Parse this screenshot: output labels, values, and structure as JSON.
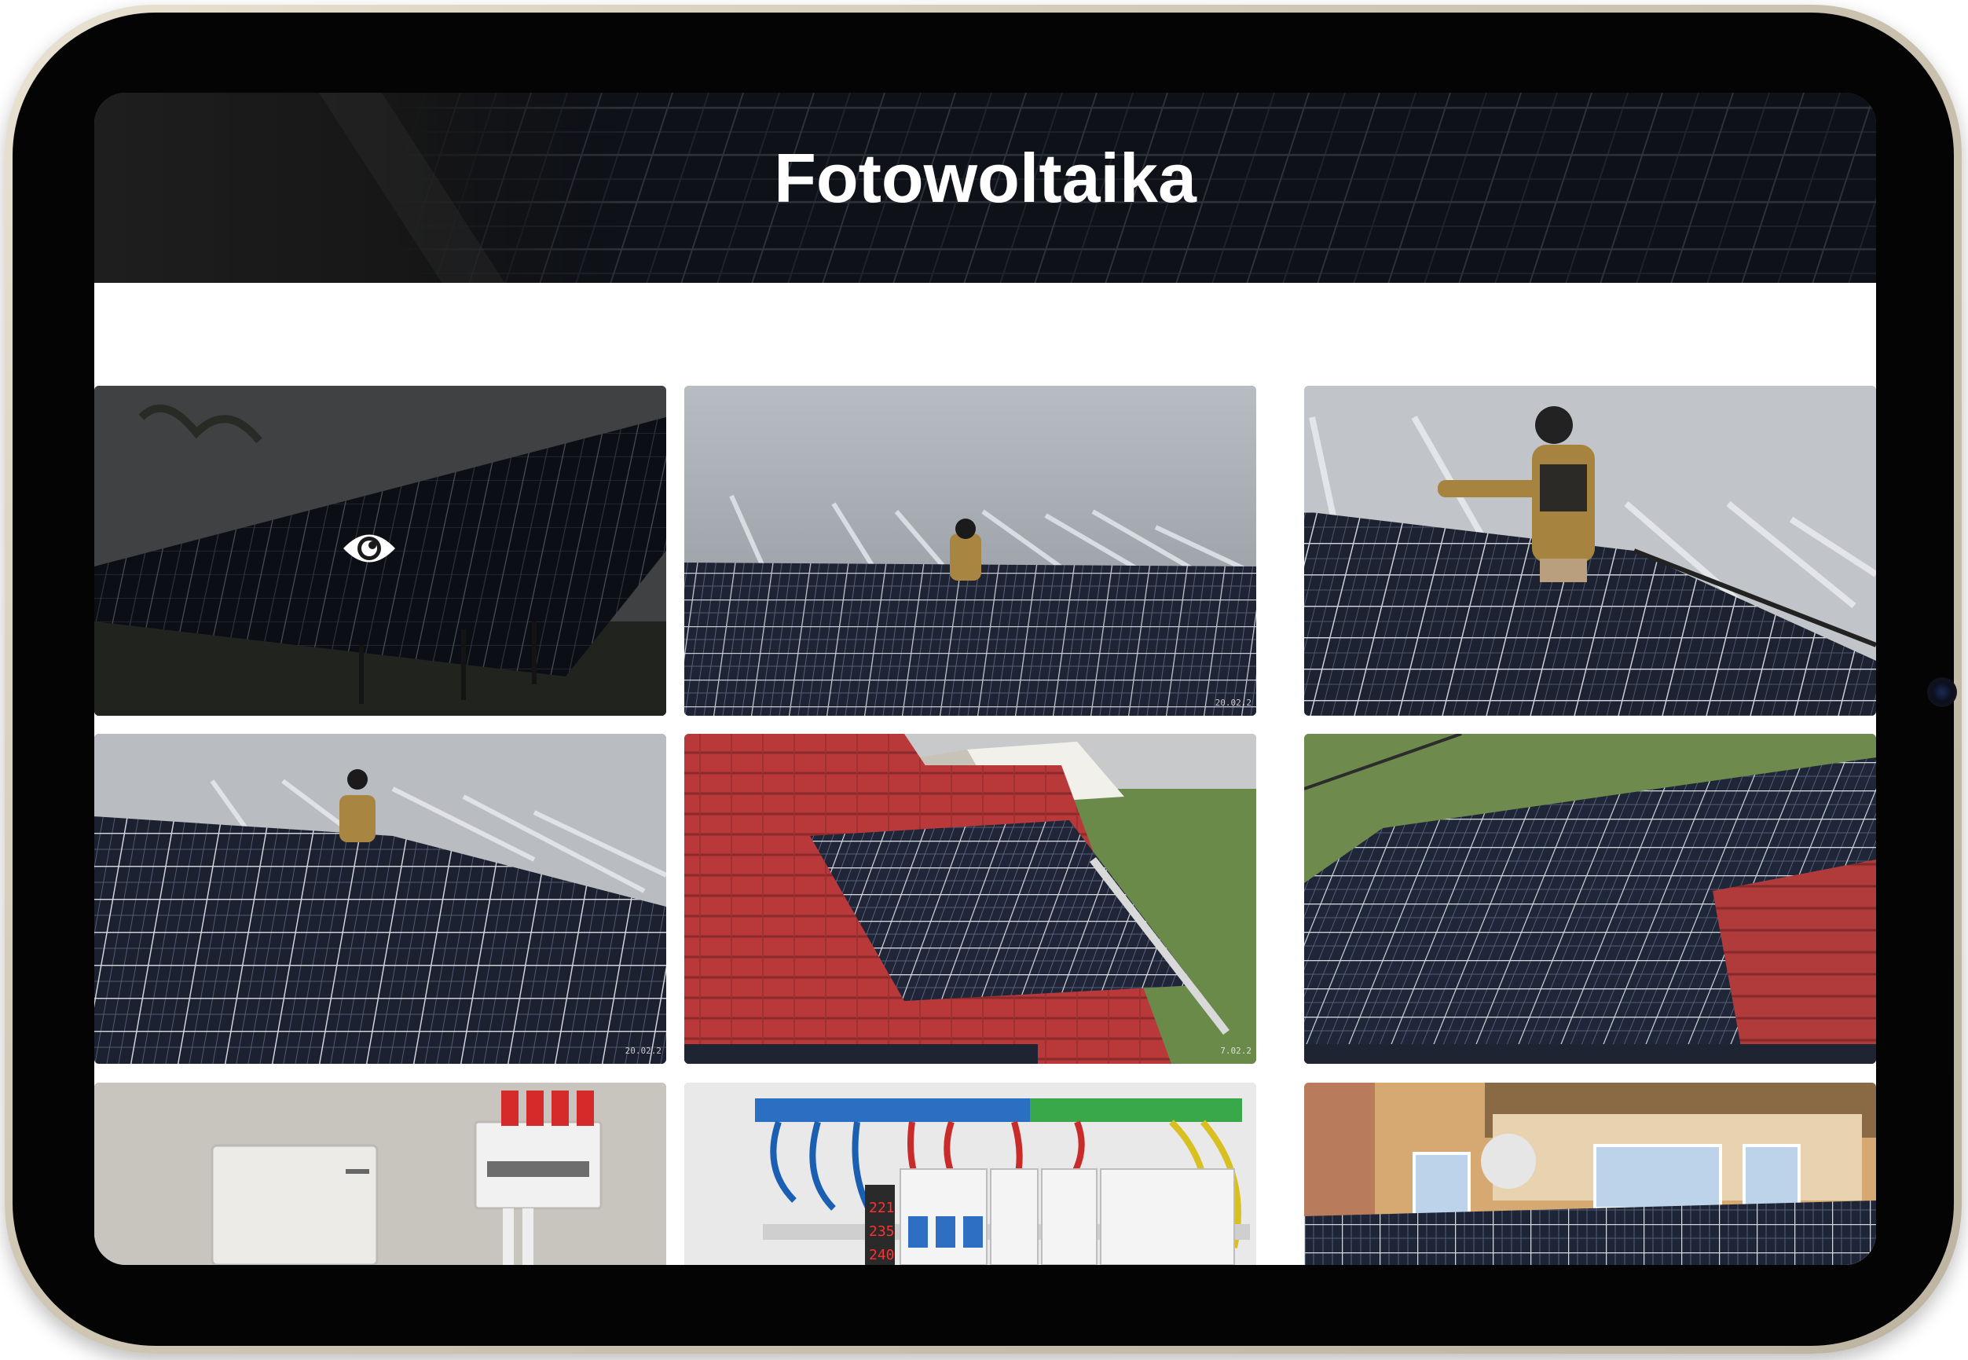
{
  "page": {
    "title": "Fotowoltaika"
  },
  "icons": {
    "view": "eye-icon"
  },
  "gallery": {
    "items": [
      {
        "alt": "ground-mounted solar array",
        "hover": true,
        "stamp": ""
      },
      {
        "alt": "installer mounting panels",
        "hover": false,
        "stamp": "20.02.2"
      },
      {
        "alt": "installer holding rail",
        "hover": false,
        "stamp": ""
      },
      {
        "alt": "installer on panel rows",
        "hover": false,
        "stamp": "20.02.2"
      },
      {
        "alt": "panels on red tile roof",
        "hover": false,
        "stamp": "7.02.2"
      },
      {
        "alt": "panels on roof near garden",
        "hover": false,
        "stamp": ""
      },
      {
        "alt": "inverter on wall",
        "hover": false,
        "stamp": ""
      },
      {
        "alt": "electrical switchboard",
        "hover": false,
        "stamp": ""
      },
      {
        "alt": "panels on balcony facade",
        "hover": false,
        "stamp": ""
      }
    ]
  },
  "colors": {
    "bezel": "#040404",
    "frame": "#d8cfbc",
    "roof_red": "#b9393a",
    "panel": "#1f2533"
  }
}
